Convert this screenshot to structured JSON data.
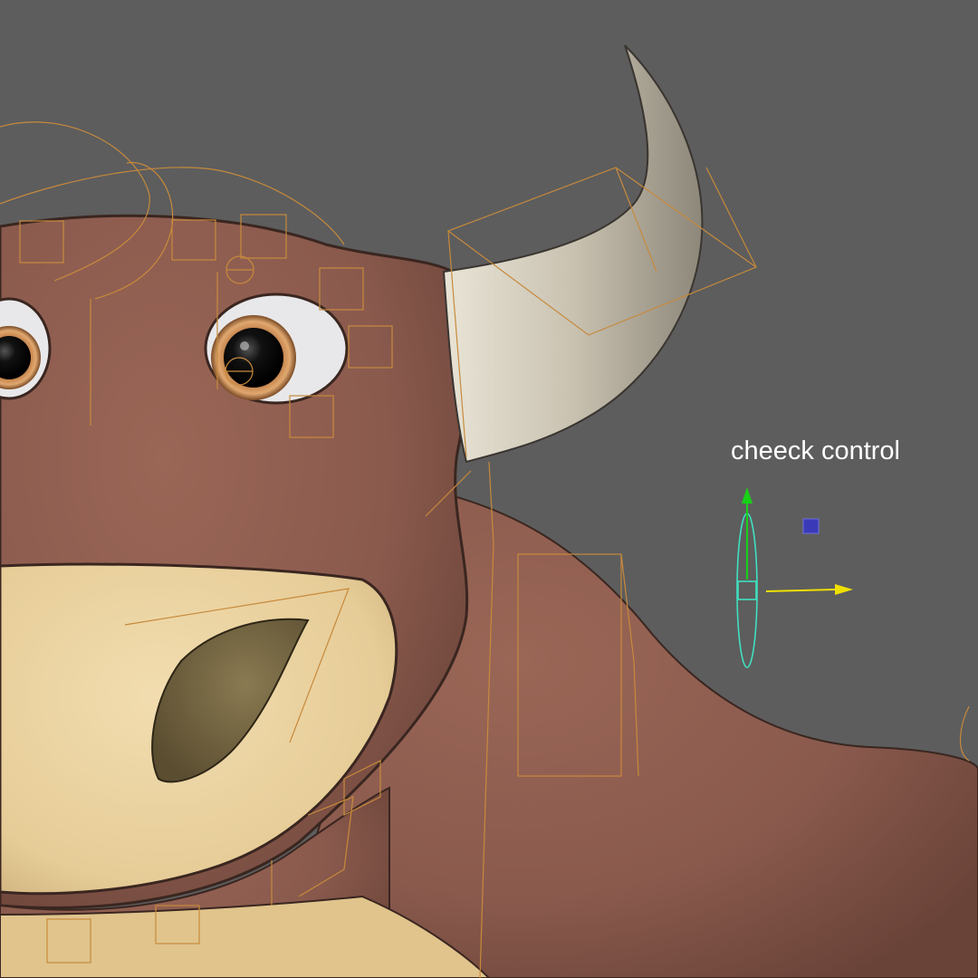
{
  "viewport": {
    "label": "cheeck control",
    "background_color": "#5d5d5d"
  },
  "character": {
    "fur_color": "#8a5a4d",
    "muzzle_color": "#e8cf9a",
    "horn_color": "#cdc7b7",
    "iris_color": "#c07a3f"
  },
  "rig": {
    "joint_color": "#c78a3c",
    "selected_control_color": "#3fe0c0",
    "y_axis_color": "#18d018",
    "x_axis_color": "#f0e000",
    "pivot_handle_color": "#3a3ab8"
  },
  "icons": {
    "move_manipulator": "move-manipulator-icon",
    "pivot_handle": "pivot-handle-icon"
  }
}
